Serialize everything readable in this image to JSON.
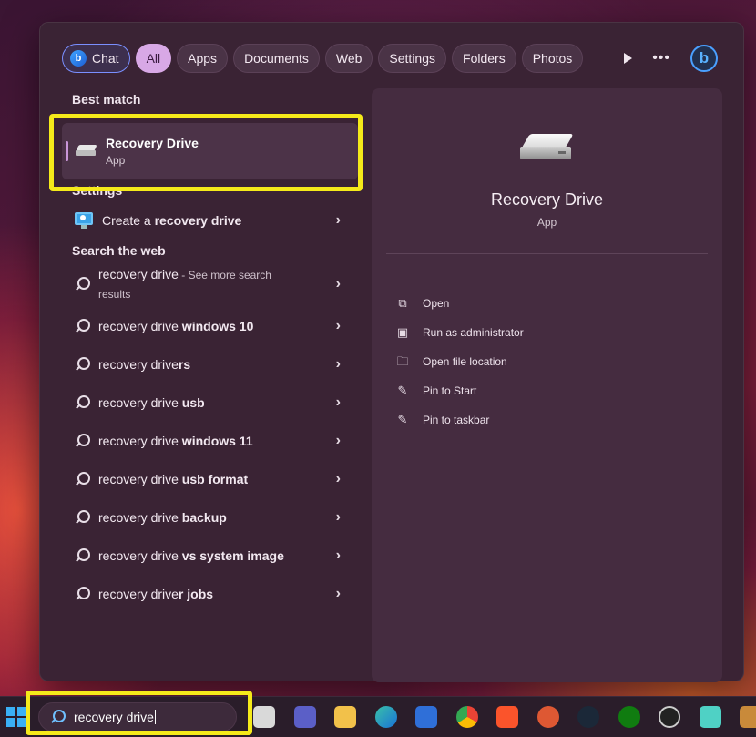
{
  "filters": {
    "chat": "Chat",
    "items": [
      "All",
      "Apps",
      "Documents",
      "Web",
      "Settings",
      "Folders",
      "Photos"
    ]
  },
  "best_match": {
    "heading": "Best match",
    "title": "Recovery Drive",
    "subtitle": "App"
  },
  "settings": {
    "heading": "Settings",
    "item_pre": "Create a ",
    "item_bold": "recovery drive"
  },
  "web": {
    "heading": "Search the web",
    "first": {
      "query": "recovery drive",
      "note": " - See more search",
      "note2": "results"
    },
    "items": [
      {
        "pre": "recovery drive",
        "bold": " windows 10"
      },
      {
        "pre": "recovery drive",
        "bold": "rs"
      },
      {
        "pre": "recovery drive",
        "bold": " usb"
      },
      {
        "pre": "recovery drive",
        "bold": " windows 11"
      },
      {
        "pre": "recovery drive",
        "bold": " usb format"
      },
      {
        "pre": "recovery drive",
        "bold": " backup"
      },
      {
        "pre": "recovery drive",
        "bold": " vs system image"
      },
      {
        "pre": "recovery drive",
        "bold": "r jobs"
      }
    ]
  },
  "preview": {
    "title": "Recovery Drive",
    "subtitle": "App",
    "actions": [
      "Open",
      "Run as administrator",
      "Open file location",
      "Pin to Start",
      "Pin to taskbar"
    ]
  },
  "taskbar": {
    "search_value": "recovery drive"
  },
  "colors": {
    "highlight": "#f5ea1a",
    "active_filter": "#d8a8e6",
    "panel": "#3a2334"
  }
}
